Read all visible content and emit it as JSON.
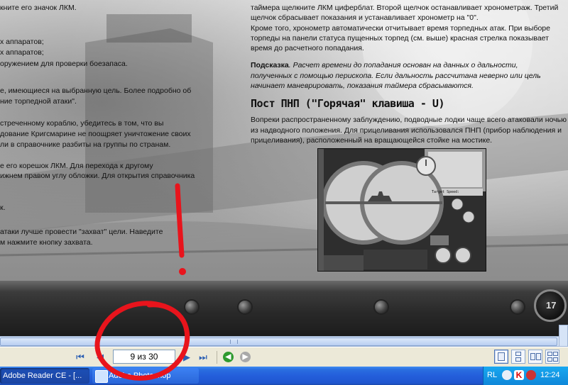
{
  "left_column": [
    "кните его значок ЛКМ.",
    "",
    "х аппаратов;",
    "х аппаратов;",
    "оружением для проверки боезапаса.",
    "е, имеющиеся на выбранную цель. Более подробно об",
    "ние торпедной атаки\".",
    "стреченному кораблю, убедитесь в том, что вы",
    "дование Кригсмарине не поощряет уничтожение своих",
    "ли в справочнике разбиты на группы по странам.",
    "е его корешок ЛКМ. Для перехода к другому",
    "ижнем правом углу обложки. Для открытия справочника",
    "к.",
    "атаки лучше провести \"захват\" цели. Наведите",
    "м нажмите кнопку захвата."
  ],
  "right_top": [
    "таймера щелкните ЛКМ циферблат. Второй щелчок останавливает хронометраж. Третий",
    "щелчок сбрасывает показания и устанавливает хронометр на \"0\".",
    "Кроме того, хронометр автоматически отчитывает время торпедных атак. При выборе",
    "торпеды на панели статуса пущенных торпед (см. выше) красная стрелка показывает",
    "время до расчетного попадания."
  ],
  "hint": {
    "label": "Подсказка",
    "line1": ". Расчет времени до попадания основан на данных о дальности,",
    "line2": "полученных с помощью перископа. Если дальность рассчитана неверно или цель",
    "line3": "начинает маневрировать, показания таймера сбрасываются."
  },
  "section_heading": "Пост ПНП (\"Горячая\" клавиша - U)",
  "section_body": [
    "Вопреки распространенному заблуждению, подводные лодки чаще всего атаковали ночью",
    "из надводного положения. Для прицеливания использовался ПНП (прибор наблюдения и",
    "прицеливания), расположенный на вращающейся стойке на мостике."
  ],
  "figure_caption_label": "Target Speed:",
  "band_number": "17",
  "navigation": {
    "page_indicator": "9 из 30"
  },
  "taskbar": {
    "task1": "Adobe Reader CE - [...",
    "task2": "Adobe Photoshop",
    "language": "RL",
    "clock": "12:24"
  },
  "colors": {
    "annotation_red": "#e8141c",
    "taskbar_blue": "#245edb",
    "tray_blue": "#0f87d9"
  }
}
